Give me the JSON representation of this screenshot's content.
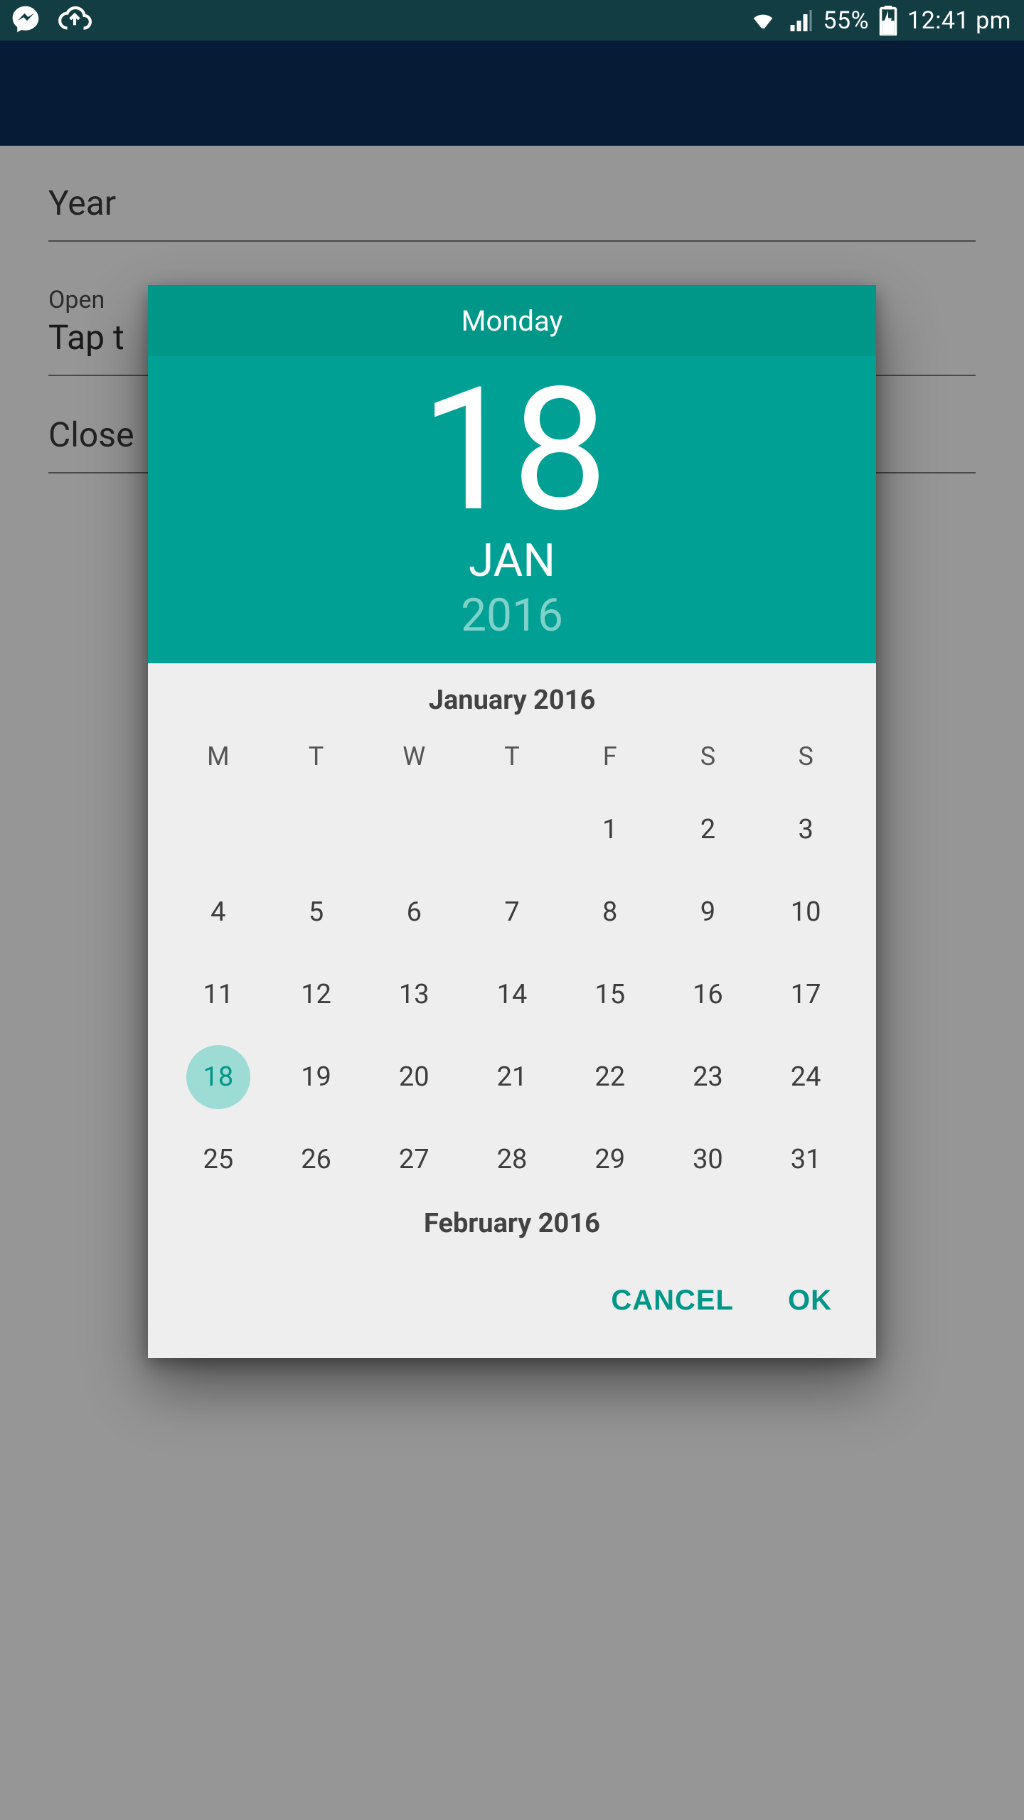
{
  "status_bar": {
    "battery_percent": "55%",
    "time": "12:41 pm"
  },
  "background": {
    "field1_label": "Year",
    "field2_label": "Open",
    "field2_value": "Tap t",
    "field3_label": "Close"
  },
  "datepicker": {
    "weekday": "Monday",
    "day": "18",
    "month_abbr": "JAN",
    "year": "2016",
    "calendar": {
      "title": "January 2016",
      "dow": [
        "M",
        "T",
        "W",
        "T",
        "F",
        "S",
        "S"
      ],
      "leading_blanks": 4,
      "days": [
        1,
        2,
        3,
        4,
        5,
        6,
        7,
        8,
        9,
        10,
        11,
        12,
        13,
        14,
        15,
        16,
        17,
        18,
        19,
        20,
        21,
        22,
        23,
        24,
        25,
        26,
        27,
        28,
        29,
        30,
        31
      ],
      "selected_day": 18,
      "next_title": "February 2016"
    },
    "actions": {
      "cancel": "CANCEL",
      "ok": "OK"
    }
  }
}
